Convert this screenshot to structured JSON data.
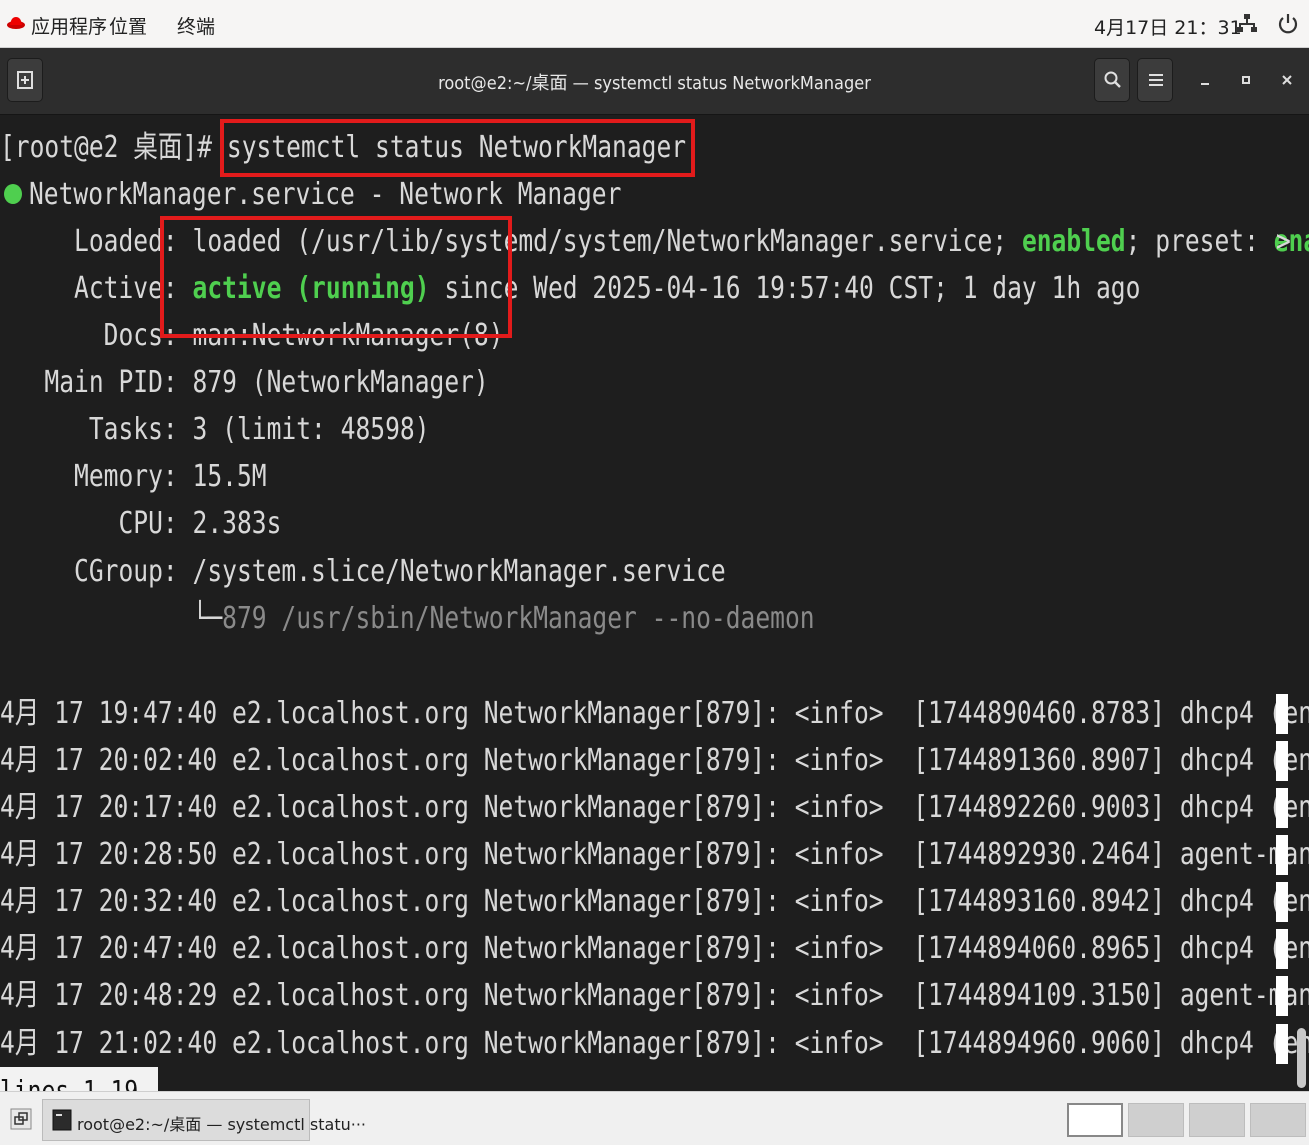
{
  "top_bar": {
    "applications": "应用程序",
    "places": "位置",
    "terminal": "终端",
    "clock": "4月17日 21：31"
  },
  "header_bar": {
    "title": "root@e2:~/桌面 — systemctl status NetworkManager"
  },
  "terminal": {
    "prompt": "[root@e2 桌面]# ",
    "command": "systemctl status NetworkManager",
    "service_line": "NetworkManager.service - Network Manager",
    "loaded_label": "     Loaded: ",
    "loaded_value": "loaded (/usr/lib/systemd/system/NetworkManager.service; ",
    "loaded_enabled": "enabled",
    "loaded_preset": "; preset: ",
    "loaded_preset_value": "ena",
    "active_label": "     Active: ",
    "active_status": "active (running)",
    "active_since": " since Wed 2025-04-16 19:57:40 CST; 1 day 1h ago",
    "docs": "       Docs: man:NetworkManager(8)",
    "main_pid": "   Main PID: 879 (NetworkManager)",
    "tasks": "      Tasks: 3 (limit: 48598)",
    "memory": "     Memory: 15.5M",
    "cpu": "        CPU: 2.383s",
    "cgroup": "     CGroup: /system.slice/NetworkManager.service",
    "cgroup_child_prefix": "             └─",
    "cgroup_child": "879 /usr/sbin/NetworkManager --no-daemon",
    "log_lines": [
      "4月 17 19:47:40 e2.localhost.org NetworkManager[879]: <info>  [1744890460.8783] dhcp4 (en",
      "4月 17 20:02:40 e2.localhost.org NetworkManager[879]: <info>  [1744891360.8907] dhcp4 (en",
      "4月 17 20:17:40 e2.localhost.org NetworkManager[879]: <info>  [1744892260.9003] dhcp4 (en",
      "4月 17 20:28:50 e2.localhost.org NetworkManager[879]: <info>  [1744892930.2464] agent-man",
      "4月 17 20:32:40 e2.localhost.org NetworkManager[879]: <info>  [1744893160.8942] dhcp4 (en",
      "4月 17 20:47:40 e2.localhost.org NetworkManager[879]: <info>  [1744894060.8965] dhcp4 (en",
      "4月 17 20:48:29 e2.localhost.org NetworkManager[879]: <info>  [1744894109.3150] agent-man",
      "4月 17 21:02:40 e2.localhost.org NetworkManager[879]: <info>  [1744894960.9060] dhcp4 (en"
    ],
    "overflow_marker": ">",
    "pager_status": "lines 1-19"
  },
  "taskbar": {
    "window_label": "root@e2:~/桌面 — systemctl statu···"
  },
  "colors": {
    "terminal_bg": "#1e1e1e",
    "highlight_green": "#4fcf4f",
    "annotation_red": "#e21b1b"
  }
}
